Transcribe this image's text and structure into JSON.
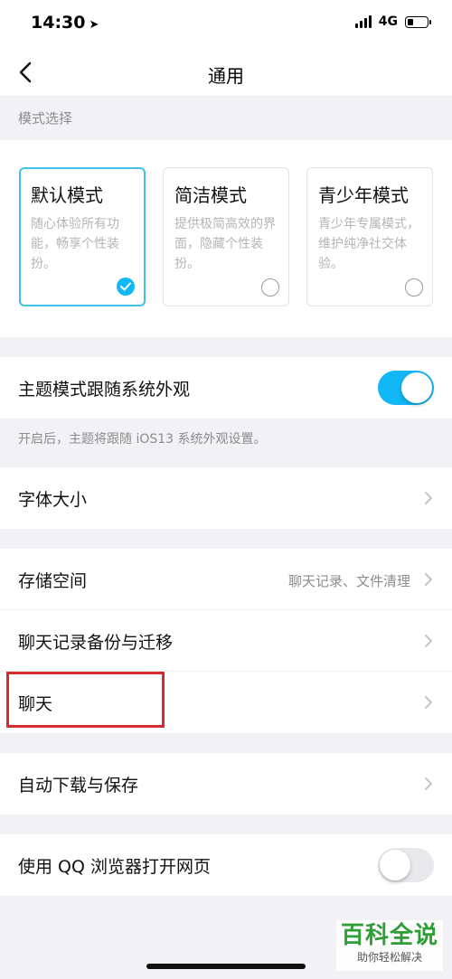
{
  "status_bar": {
    "time": "14:30",
    "network": "4G"
  },
  "nav": {
    "title": "通用"
  },
  "mode_section": {
    "label": "模式选择",
    "cards": [
      {
        "name": "默认模式",
        "desc": "随心体验所有功能，畅享个性装扮。",
        "selected": true
      },
      {
        "name": "简洁模式",
        "desc": "提供极简高效的界面，隐藏个性装扮。",
        "selected": false
      },
      {
        "name": "青少年模式",
        "desc": "青少年专属模式，维护纯净社交体验。",
        "selected": false
      }
    ]
  },
  "theme": {
    "label": "主题模式跟随系统外观",
    "enabled": true,
    "hint": "开启后，主题将跟随 iOS13 系统外观设置。"
  },
  "font_size": {
    "label": "字体大小"
  },
  "storage": {
    "label": "存储空间",
    "value": "聊天记录、文件清理"
  },
  "backup": {
    "label": "聊天记录备份与迁移"
  },
  "chat": {
    "label": "聊天"
  },
  "auto_download": {
    "label": "自动下载与保存"
  },
  "qq_browser": {
    "label": "使用 QQ 浏览器打开网页",
    "enabled": false
  },
  "watermark": {
    "title": "百科全说",
    "subtitle": "助你轻松解决"
  },
  "colors": {
    "accent": "#12b7f5",
    "highlight": "#d62b2b",
    "watermark": "#2f9e36"
  }
}
